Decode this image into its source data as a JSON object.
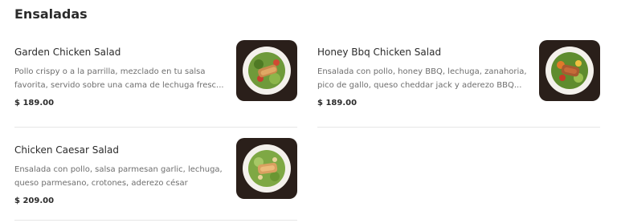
{
  "section": {
    "title": "Ensaladas"
  },
  "items": [
    {
      "name": "Garden Chicken Salad",
      "description": "Pollo crispy o a la parrilla, mezclado en tu salsa favorita, servido sobre una cama de lechuga fresc...",
      "price": "$ 189.00",
      "image_icon": "salad-plate-icon"
    },
    {
      "name": "Honey Bbq Chicken Salad",
      "description": "Ensalada con pollo, honey BBQ, lechuga, zanahoria, pico de gallo, queso cheddar jack y aderezo BBQ...",
      "price": "$ 189.00",
      "image_icon": "salad-plate-icon"
    },
    {
      "name": "Chicken Caesar Salad",
      "description": "Ensalada con pollo, salsa parmesan garlic, lechuga, queso parmesano, crotones, aderezo césar",
      "price": "$ 209.00",
      "image_icon": "salad-plate-icon"
    }
  ]
}
